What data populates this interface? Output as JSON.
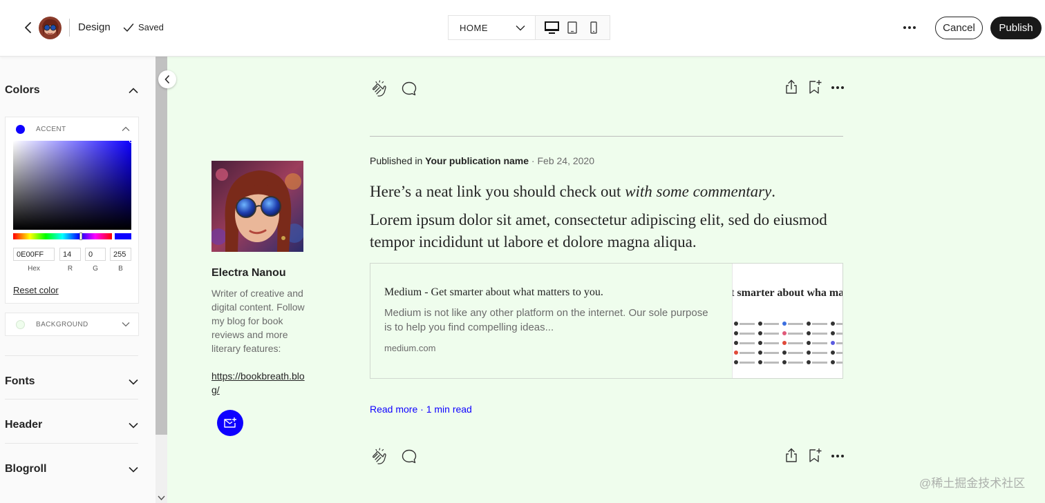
{
  "topbar": {
    "section_label": "Design",
    "saved_label": "Saved",
    "page_select": "HOME",
    "cancel_label": "Cancel",
    "publish_label": "Publish"
  },
  "sidebar": {
    "colors_heading": "Colors",
    "accent": {
      "label": "ACCENT",
      "color": "#0e00ff",
      "hex": "0E00FF",
      "r": "14",
      "g": "0",
      "b": "255",
      "hex_label": "Hex",
      "r_label": "R",
      "g_label": "G",
      "b_label": "B",
      "reset_label": "Reset color"
    },
    "background": {
      "label": "BACKGROUND",
      "color": "#effded"
    },
    "fonts_heading": "Fonts",
    "header_heading": "Header",
    "blogroll_heading": "Blogroll"
  },
  "author": {
    "name": "Electra Nanou",
    "bio": "Writer of creative and digital content. Follow my blog for book reviews and more literary features:",
    "link": "https://bookbreath.blog/"
  },
  "post": {
    "published_in": "Published in ",
    "publication": "Your publication name",
    "date": " · Feb 24, 2020",
    "title_plain": "Here’s a neat link you should check out ",
    "title_italic": "with some commentary",
    "title_end": ".",
    "body": "Lorem ipsum dolor sit amet, consectetur adipiscing elit, sed do eiusmod tempor incididunt ut labore et dolore magna aliqua.",
    "read_more": "Read more · 1 min read"
  },
  "link_card": {
    "title": "Medium - Get smarter about what matters to you.",
    "description": "Medium is not like any other platform on the internet. Our sole purpose is to help you find compelling ideas...",
    "domain": "medium.com",
    "thumb_text": "et smarter about wha matters to you."
  },
  "watermark": "@稀土掘金技术社区",
  "colors": {
    "accent": "#0e00ff",
    "canvas_bg": "#effded",
    "publish_bg": "#191919"
  }
}
